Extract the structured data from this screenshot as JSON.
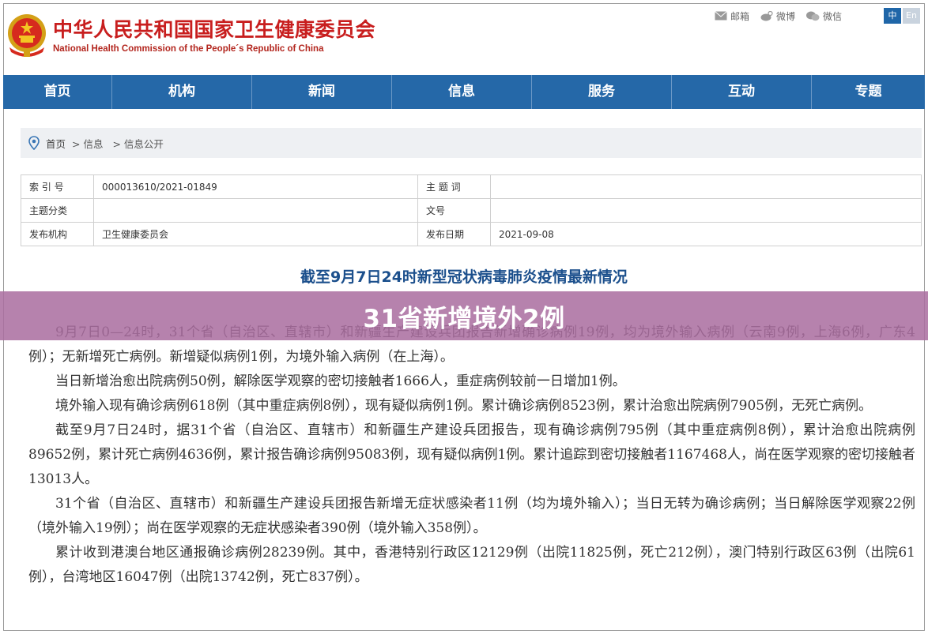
{
  "header": {
    "title_cn": "中华人民共和国国家卫生健康委员会",
    "title_en": "National Health Commission of the People´s Republic of China",
    "links": [
      {
        "icon": "mail-icon",
        "label": "邮箱"
      },
      {
        "icon": "weibo-icon",
        "label": "微博"
      },
      {
        "icon": "wechat-icon",
        "label": "微信"
      }
    ],
    "lang_cn": "中",
    "lang_en": "En"
  },
  "nav": [
    "首页",
    "机构",
    "新闻",
    "信息",
    "服务",
    "互动",
    "专题"
  ],
  "breadcrumb": {
    "home": "首页",
    "level1": "> 信息",
    "level2": "> 信息公开"
  },
  "meta": {
    "index_label": "索 引 号",
    "index_value": "000013610/2021-01849",
    "keyword_label": "主 题 词",
    "keyword_value": "",
    "category_label": "主题分类",
    "category_value": "",
    "docno_label": "文号",
    "docno_value": "",
    "issuer_label": "发布机构",
    "issuer_value": "卫生健康委员会",
    "date_label": "发布日期",
    "date_value": "2021-09-08"
  },
  "article": {
    "title": "截至9月7日24时新型冠状病毒肺炎疫情最新情况",
    "paragraphs": [
      "9月7日0—24时，31个省（自治区、直辖市）和新疆生产建设兵团报告新增确诊病例19例，均为境外输入病例（云南9例，上海6例，广东4例）；无新增死亡病例。新增疑似病例1例，为境外输入病例（在上海）。",
      "当日新增治愈出院病例50例，解除医学观察的密切接触者1666人，重症病例较前一日增加1例。",
      "境外输入现有确诊病例618例（其中重症病例8例），现有疑似病例1例。累计确诊病例8523例，累计治愈出院病例7905例，无死亡病例。",
      "截至9月7日24时，据31个省（自治区、直辖市）和新疆生产建设兵团报告，现有确诊病例795例（其中重症病例8例），累计治愈出院病例89652例，累计死亡病例4636例，累计报告确诊病例95083例，现有疑似病例1例。累计追踪到密切接触者1167468人，尚在医学观察的密切接触者13013人。",
      "31个省（自治区、直辖市）和新疆生产建设兵团报告新增无症状感染者11例（均为境外输入）；当日无转为确诊病例；当日解除医学观察22例（境外输入19例）；尚在医学观察的无症状感染者390例（境外输入358例）。",
      "累计收到港澳台地区通报确诊病例28239例。其中，香港特别行政区12129例（出院11825例，死亡212例），澳门特别行政区63例（出院61例），台湾地区16047例（出院13742例，死亡837例）。"
    ]
  },
  "banner": {
    "text": "31省新增境外2例"
  },
  "colors": {
    "nav": "#2568a8",
    "title_red": "#c81e1e",
    "article_title": "#1b4f8c",
    "banner": "#aa6ea0"
  }
}
